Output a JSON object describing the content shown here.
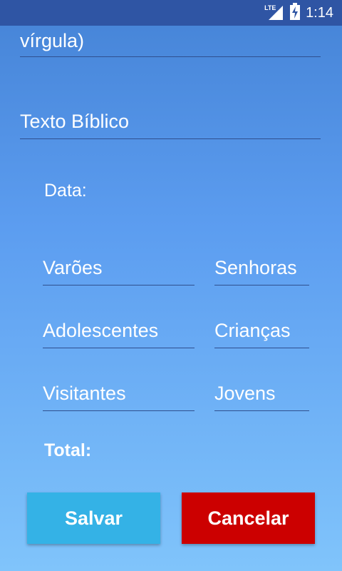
{
  "status_bar": {
    "network_label": "LTE",
    "time": "1:14",
    "icons": [
      "signal-icon",
      "battery-charging-icon"
    ]
  },
  "form": {
    "top_field_visible_text": "vírgula)",
    "bible_text_hint": "Texto Bíblico",
    "date_label": "Data:",
    "counts": {
      "men_hint": "Varões",
      "women_hint": "Senhoras",
      "teens_hint": "Adolescentes",
      "children_hint": "Crianças",
      "visitors_hint": "Visitantes",
      "youth_hint": "Jovens"
    },
    "total_label": "Total:"
  },
  "actions": {
    "save_label": "Salvar",
    "cancel_label": "Cancelar"
  },
  "colors": {
    "status_bar": "#2f55a4",
    "save_button": "#34b2e6",
    "cancel_button": "#cc0000",
    "underline": "#2f4f8f"
  }
}
